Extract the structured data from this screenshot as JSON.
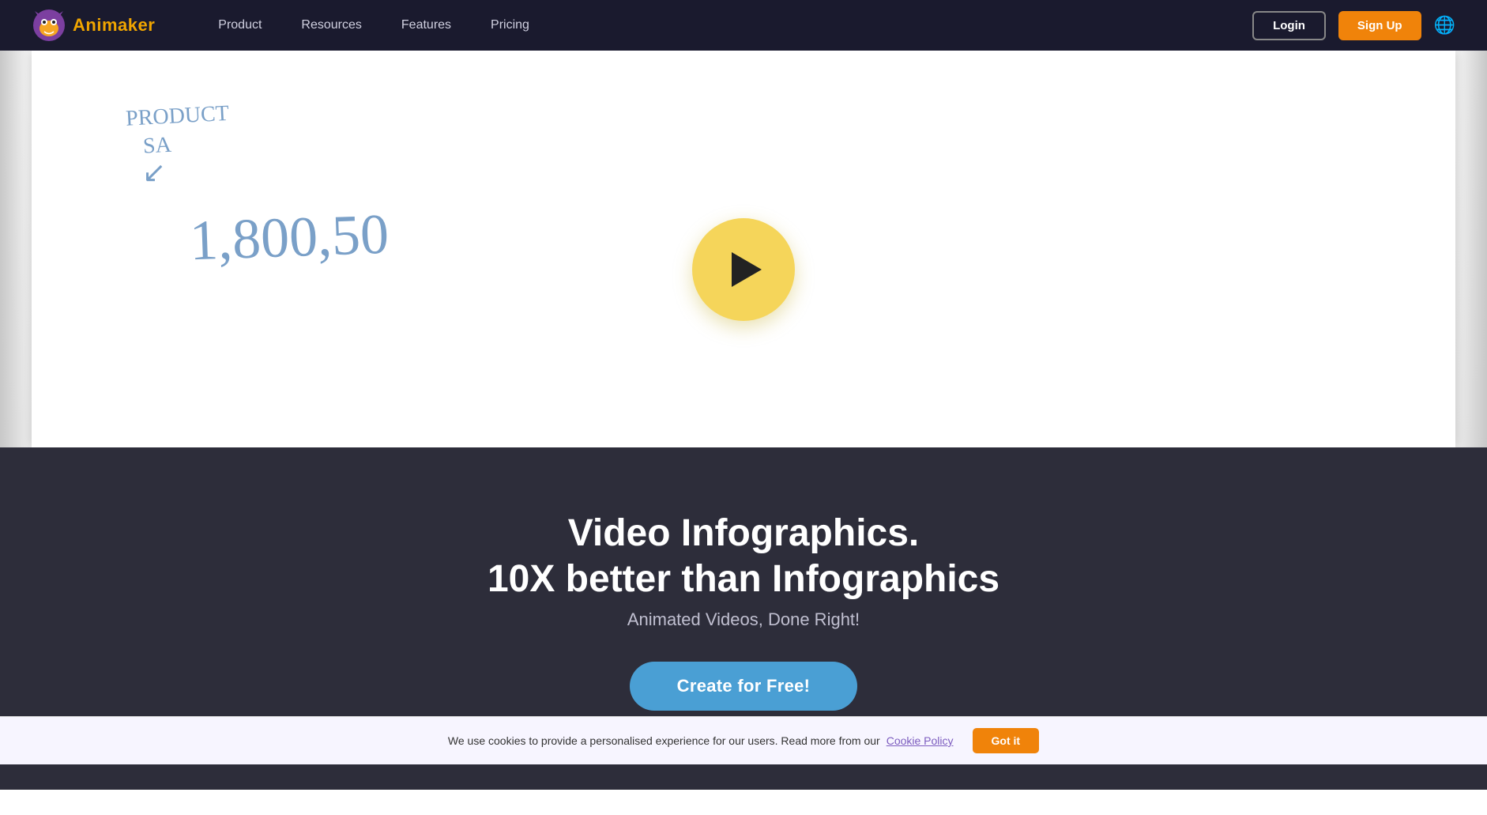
{
  "brand": {
    "name": "Animaker",
    "logo_alt": "Animaker Logo"
  },
  "navbar": {
    "links": [
      {
        "label": "Product",
        "href": "#"
      },
      {
        "label": "Resources",
        "href": "#"
      },
      {
        "label": "Features",
        "href": "#"
      },
      {
        "label": "Pricing",
        "href": "#"
      }
    ],
    "login_label": "Login",
    "signup_label": "Sign Up"
  },
  "hero": {
    "handwritten_title_line1": "PRODUCT",
    "handwritten_title_line2": "SA",
    "handwritten_number": "1,800,50",
    "play_button_label": "Play video"
  },
  "marketing": {
    "headline_bold": "Video Infographics.",
    "headline_sub": "10X better than Infographics",
    "subtext": "Animated Videos, Done Right!",
    "cta_label": "Create for Free!"
  },
  "cookie": {
    "message": "We use cookies to provide a personalised experience for our users. Read more from our",
    "policy_link_text": "Cookie Policy",
    "got_it_label": "Got it"
  }
}
